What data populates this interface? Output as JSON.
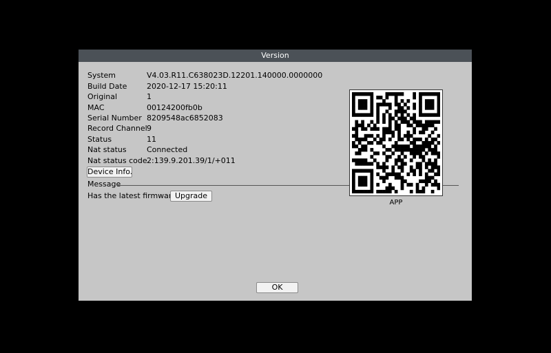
{
  "dialog": {
    "title": "Version"
  },
  "info": [
    {
      "label": "System",
      "value": "V4.03.R11.C638023D.12201.140000.0000000"
    },
    {
      "label": "Build Date",
      "value": "2020-12-17 15:20:11"
    },
    {
      "label": "Original",
      "value": "1"
    },
    {
      "label": "MAC",
      "value": "00124200fb0b"
    },
    {
      "label": "Serial Number",
      "value": "8209548ac6852083"
    },
    {
      "label": "Record Channel",
      "value": "9"
    },
    {
      "label": "Status",
      "value": "11"
    },
    {
      "label": "Nat status",
      "value": "Connected"
    },
    {
      "label": "Nat status code",
      "value": "2:139.9.201.39/1/+011"
    }
  ],
  "device_info_button": "Device Info.",
  "message": {
    "label": "Message",
    "firmware_text": "Has the latest firmware",
    "upgrade_button": "Upgrade"
  },
  "qr": {
    "caption": "APP"
  },
  "ok_button": "OK"
}
